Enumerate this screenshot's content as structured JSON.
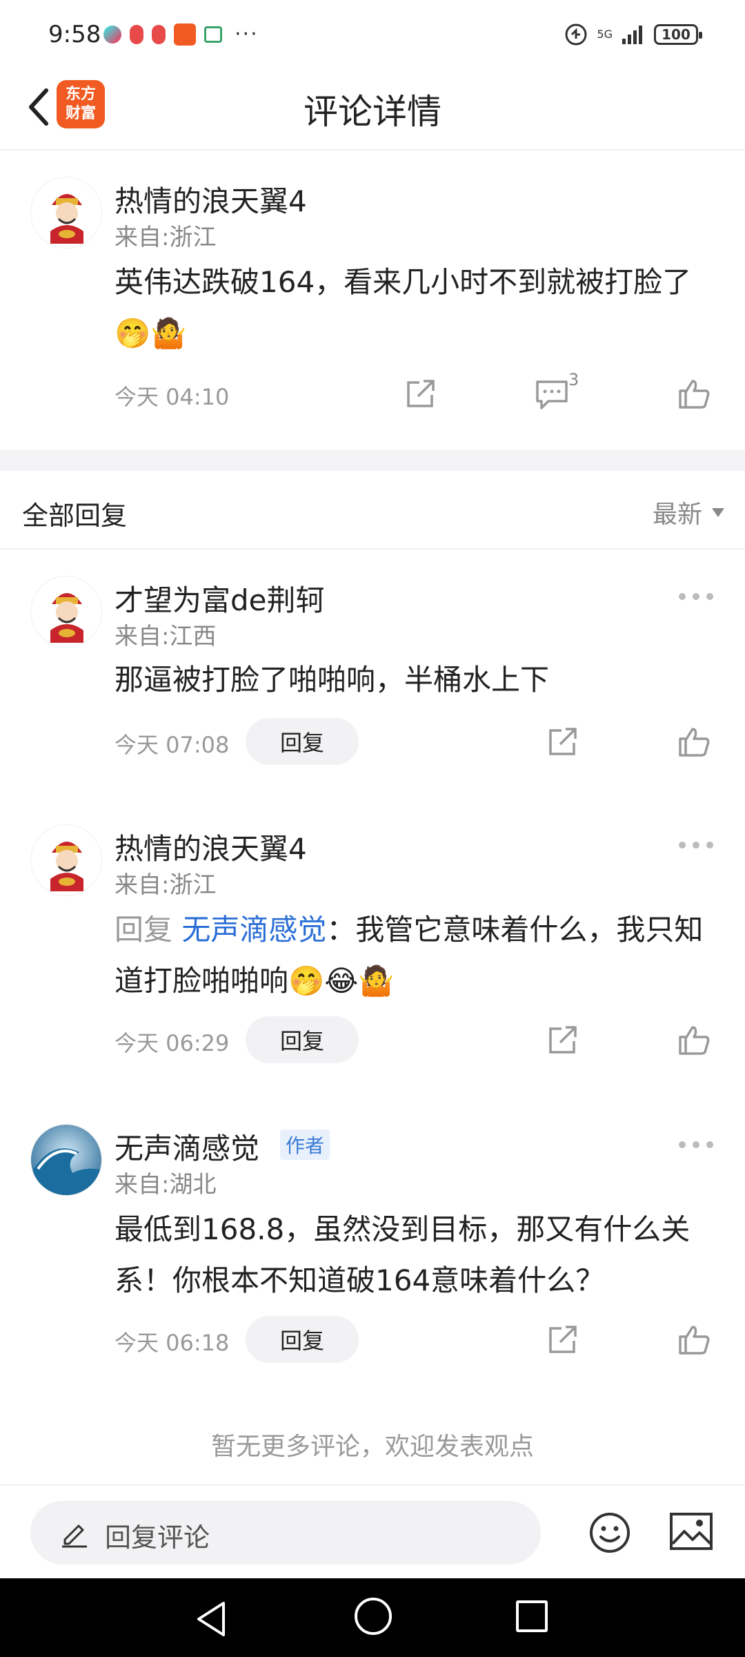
{
  "status_bar": {
    "time": "9:58",
    "network": "5G",
    "battery": "100"
  },
  "header": {
    "title": "评论详情",
    "logo_text": "东方财富"
  },
  "main_comment": {
    "username": "热情的浪天翼4",
    "location": "来自:浙江",
    "content": "英伟达跌破164，看来几小时不到就被打脸了🤭🤷",
    "time": "今天 04:10",
    "comment_count": "3"
  },
  "replies_section": {
    "title": "全部回复",
    "sort_label": "最新"
  },
  "replies": [
    {
      "username": "才望为富de荆轲",
      "location": "来自:江西",
      "content": "那逼被打脸了啪啪响，半桶水上下",
      "time": "今天 07:08",
      "reply_label": "回复"
    },
    {
      "username": "热情的浪天翼4",
      "location": "来自:浙江",
      "reply_prefix": "回复",
      "mention": "无声滴感觉",
      "content": "：我管它意味着什么，我只知道打脸啪啪响🤭😂🤷",
      "time": "今天 06:29",
      "reply_label": "回复"
    },
    {
      "username": "无声滴感觉",
      "author_tag": "作者",
      "location": "来自:湖北",
      "content": "最低到168.8，虽然没到目标，那又有什么关系！你根本不知道破164意味着什么？",
      "time": "今天 06:18",
      "reply_label": "回复"
    }
  ],
  "footer_text": "暂无更多评论，欢迎发表观点",
  "bottom_bar": {
    "placeholder": "回复评论"
  },
  "colors": {
    "accent": "#2b6fd6",
    "logo": "#f15a22"
  }
}
